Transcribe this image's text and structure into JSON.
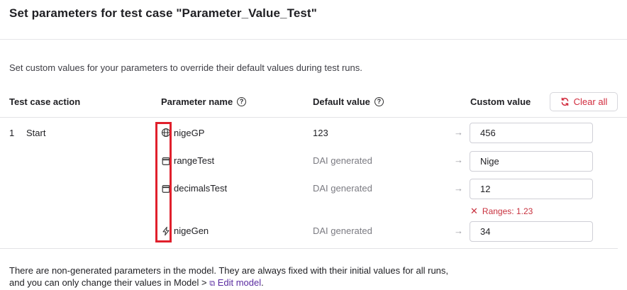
{
  "header": {
    "title": "Set parameters for test case \"Parameter_Value_Test\""
  },
  "subtitle": "Set custom values for your parameters to override their default values during test runs.",
  "columns": {
    "action": "Test case action",
    "param": "Parameter name",
    "default": "Default value",
    "custom": "Custom value"
  },
  "clear_all": {
    "label": "Clear all",
    "icon": "refresh-icon",
    "color": "#d12b3d"
  },
  "row": {
    "index": "1",
    "action": "Start"
  },
  "params": [
    {
      "icon": "globe-icon",
      "name": "nigeGP",
      "default": "123",
      "custom": "456",
      "default_muted": false
    },
    {
      "icon": "calendar-icon",
      "name": "rangeTest",
      "default": "DAI generated",
      "custom": "Nige",
      "default_muted": true
    },
    {
      "icon": "calendar-icon",
      "name": "decimalsTest",
      "default": "DAI generated",
      "custom": "12",
      "default_muted": true
    },
    {
      "icon": "lightning-icon",
      "name": "nigeGen",
      "default": "DAI generated",
      "custom": "34",
      "default_muted": true
    }
  ],
  "validation_error": "Ranges: 1.23",
  "arrow_glyph": "→",
  "footer": {
    "line1": "There are non-generated parameters in the model. They are always fixed with their initial values for all runs,",
    "line2_prefix": "and you can only change their values in Model > ",
    "link": "Edit model",
    "line2_suffix": "."
  }
}
